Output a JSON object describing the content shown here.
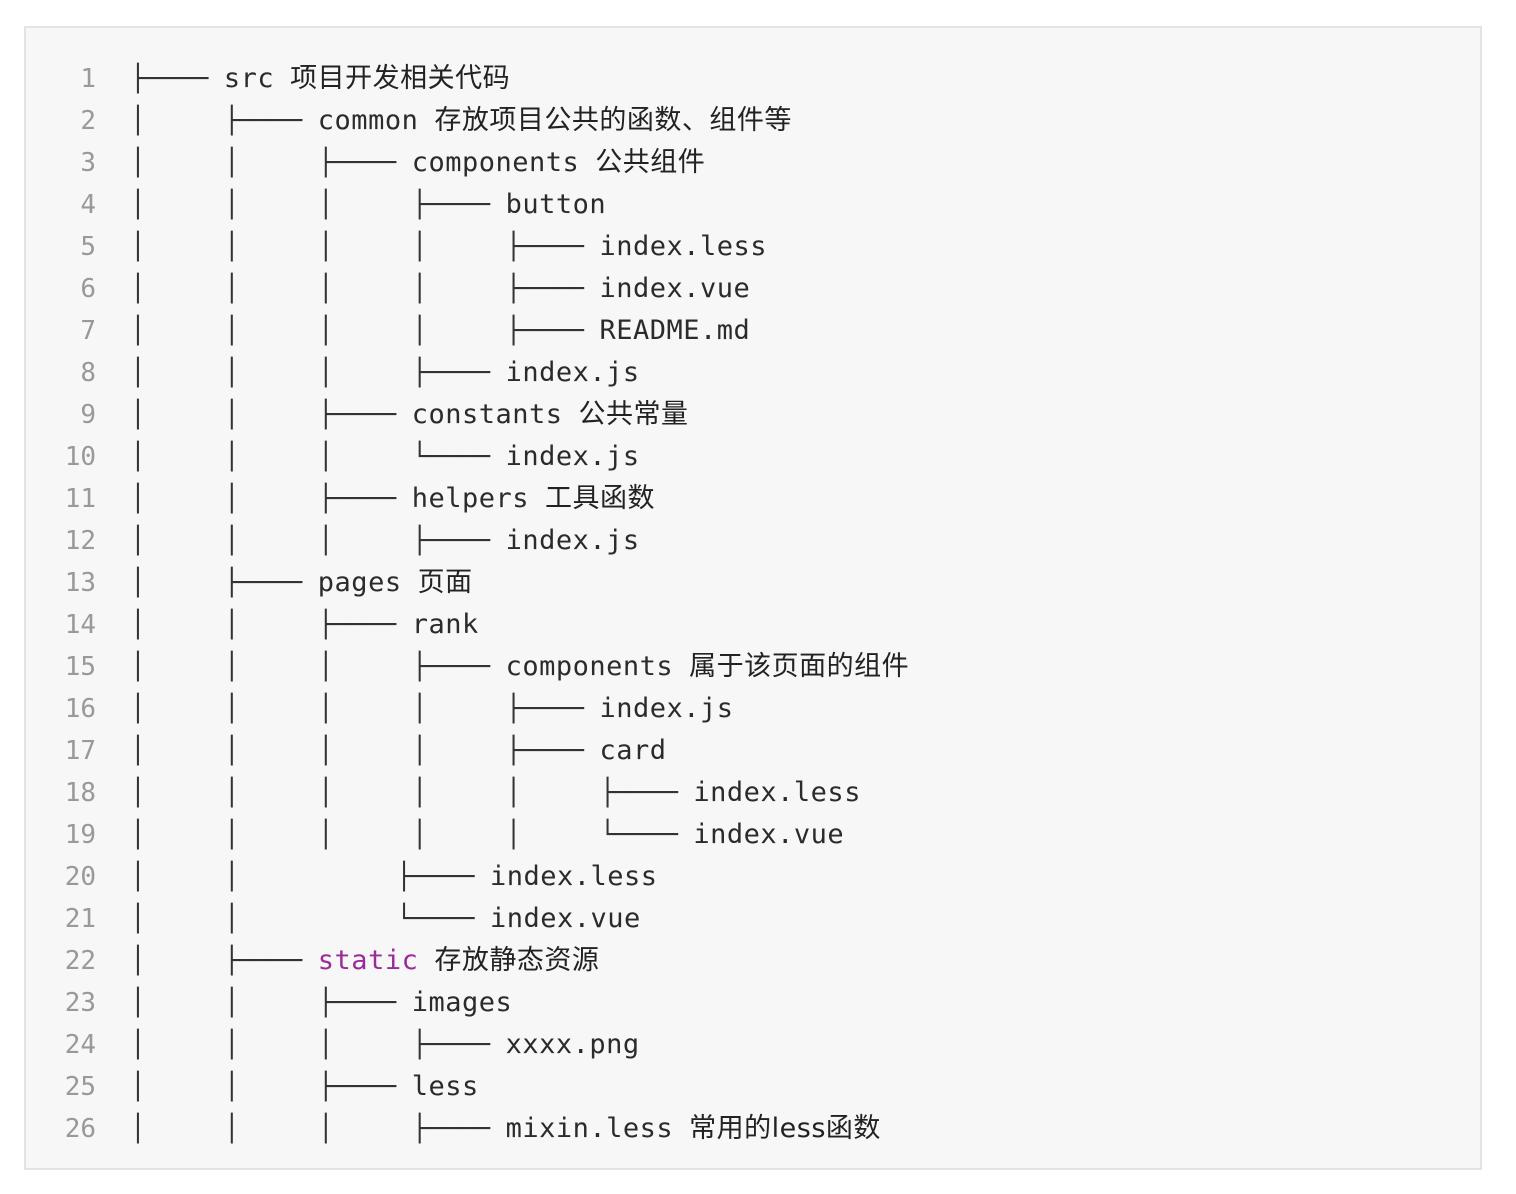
{
  "colors": {
    "background": "#f7f7f7",
    "border": "#e3e3e3",
    "line_number": "#999999",
    "text": "#2b2b2b",
    "keyword": "#9a2a9a"
  },
  "lines": [
    {
      "num": "1",
      "prefix": "├──── ",
      "name": "src",
      "comment": "项目开发相关代码"
    },
    {
      "num": "2",
      "prefix": "│     ├──── ",
      "name": "common",
      "comment": "存放项目公共的函数、组件等"
    },
    {
      "num": "3",
      "prefix": "│     │     ├──── ",
      "name": "components",
      "comment": "公共组件"
    },
    {
      "num": "4",
      "prefix": "│     │     │     ├──── ",
      "name": "button",
      "comment": ""
    },
    {
      "num": "5",
      "prefix": "│     │     │     │     ├──── ",
      "name": "index.less",
      "comment": ""
    },
    {
      "num": "6",
      "prefix": "│     │     │     │     ├──── ",
      "name": "index.vue",
      "comment": ""
    },
    {
      "num": "7",
      "prefix": "│     │     │     │     ├──── ",
      "name": "README.md",
      "comment": ""
    },
    {
      "num": "8",
      "prefix": "│     │     │     ├──── ",
      "name": "index.js",
      "comment": ""
    },
    {
      "num": "9",
      "prefix": "│     │     ├──── ",
      "name": "constants",
      "comment": "公共常量"
    },
    {
      "num": "10",
      "prefix": "│     │     │     └──── ",
      "name": "index.js",
      "comment": ""
    },
    {
      "num": "11",
      "prefix": "│     │     ├──── ",
      "name": "helpers",
      "comment": "工具函数"
    },
    {
      "num": "12",
      "prefix": "│     │     │     ├──── ",
      "name": "index.js",
      "comment": ""
    },
    {
      "num": "13",
      "prefix": "│     ├──── ",
      "name": "pages",
      "comment": "页面"
    },
    {
      "num": "14",
      "prefix": "│     │     ├──── ",
      "name": "rank",
      "comment": ""
    },
    {
      "num": "15",
      "prefix": "│     │     │     ├──── ",
      "name": "components",
      "comment": "属于该页面的组件"
    },
    {
      "num": "16",
      "prefix": "│     │     │     │     ├──── ",
      "name": "index.js",
      "comment": ""
    },
    {
      "num": "17",
      "prefix": "│     │     │     │     ├──── ",
      "name": "card",
      "comment": ""
    },
    {
      "num": "18",
      "prefix": "│     │     │     │     │     ├──── ",
      "name": "index.less",
      "comment": ""
    },
    {
      "num": "19",
      "prefix": "│     │     │     │     │     └──── ",
      "name": "index.vue",
      "comment": ""
    },
    {
      "num": "20",
      "prefix": "│     │          ├──── ",
      "name": "index.less",
      "comment": ""
    },
    {
      "num": "21",
      "prefix": "│     │          └──── ",
      "name": "index.vue",
      "comment": ""
    },
    {
      "num": "22",
      "prefix": "│     ├──── ",
      "name": "static",
      "comment": "存放静态资源",
      "keyword": true
    },
    {
      "num": "23",
      "prefix": "│     │     ├──── ",
      "name": "images",
      "comment": ""
    },
    {
      "num": "24",
      "prefix": "│     │     │     ├──── ",
      "name": "xxxx.png",
      "comment": ""
    },
    {
      "num": "25",
      "prefix": "│     │     ├──── ",
      "name": "less",
      "comment": ""
    },
    {
      "num": "26",
      "prefix": "│     │     │     ├──── ",
      "name": "mixin.less",
      "comment": "常用的less函数"
    }
  ]
}
